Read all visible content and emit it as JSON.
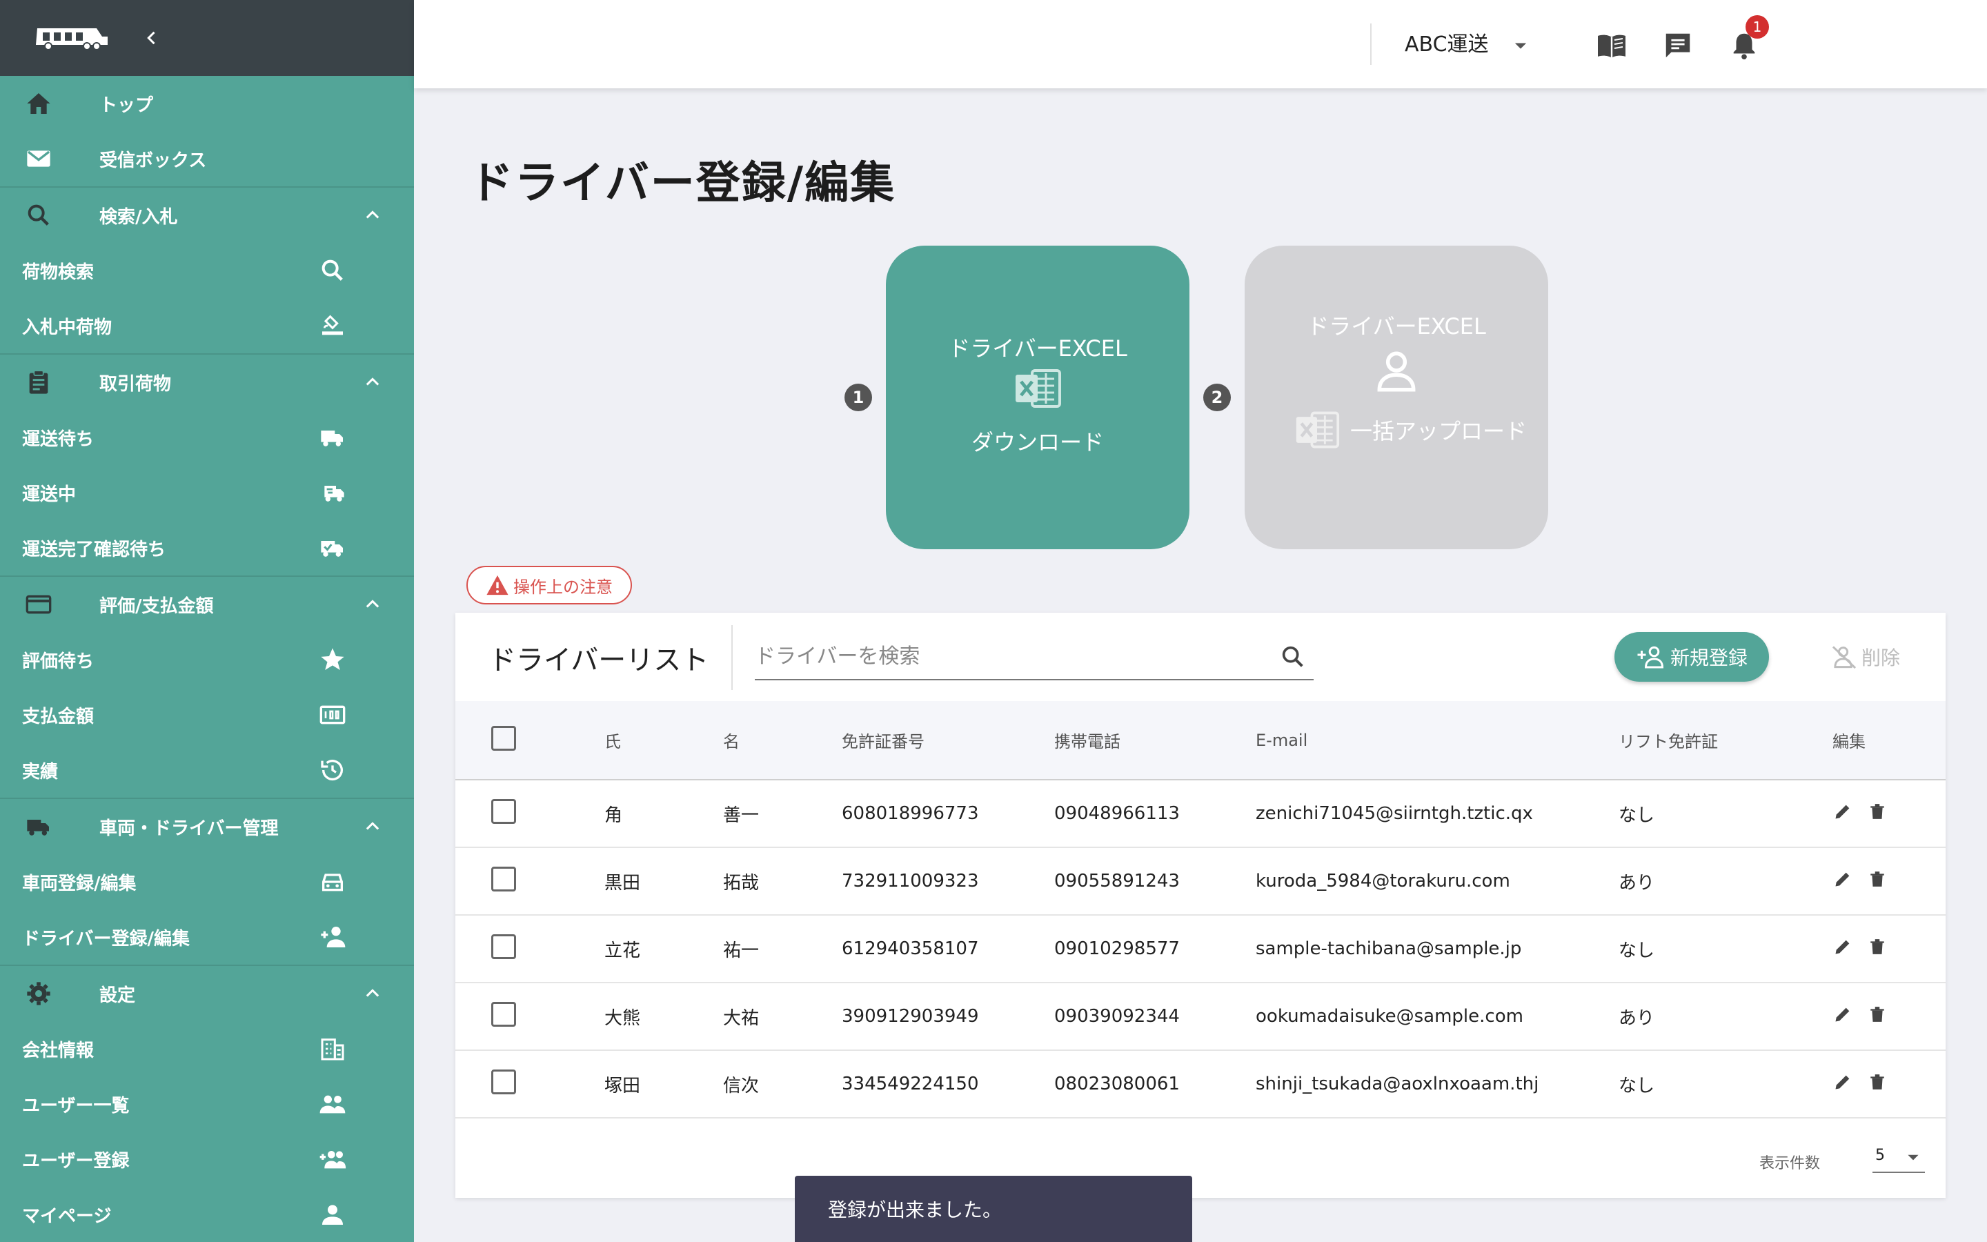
{
  "colors": {
    "accent": "#53a598",
    "sidebar_header": "#3a4348",
    "danger": "#d9534f",
    "badge": "#d32f2f"
  },
  "sidebar": {
    "rows": [
      {
        "type": "section",
        "label": "トップ",
        "icon": "home-icon",
        "chevron": false
      },
      {
        "type": "section",
        "label": "受信ボックス",
        "icon": "mail-icon",
        "chevron": false
      },
      {
        "type": "section",
        "label": "検索/入札",
        "icon": "search-icon",
        "chevron": true
      },
      {
        "type": "sub",
        "label": "荷物検索",
        "icon": "search-icon"
      },
      {
        "type": "sub",
        "label": "入札中荷物",
        "icon": "gavel-icon"
      },
      {
        "type": "section",
        "label": "取引荷物",
        "icon": "clipboard-icon",
        "chevron": true
      },
      {
        "type": "sub",
        "label": "運送待ち",
        "icon": "truck-icon"
      },
      {
        "type": "sub",
        "label": "運送中",
        "icon": "truck-fast-icon"
      },
      {
        "type": "sub",
        "label": "運送完了確認待ち",
        "icon": "truck-check-icon"
      },
      {
        "type": "section",
        "label": "評価/支払金額",
        "icon": "credit-card-icon",
        "chevron": true
      },
      {
        "type": "sub",
        "label": "評価待ち",
        "icon": "star-icon"
      },
      {
        "type": "sub",
        "label": "支払金額",
        "icon": "counter-icon"
      },
      {
        "type": "sub",
        "label": "実績",
        "icon": "history-icon"
      },
      {
        "type": "section",
        "label": "車両・ドライバー管理",
        "icon": "truck-icon",
        "chevron": true
      },
      {
        "type": "sub",
        "label": "車両登録/編集",
        "icon": "car-icon"
      },
      {
        "type": "sub",
        "label": "ドライバー登録/編集",
        "icon": "person-add-icon"
      },
      {
        "type": "section",
        "label": "設定",
        "icon": "gear-icon",
        "chevron": true
      },
      {
        "type": "sub",
        "label": "会社情報",
        "icon": "building-icon"
      },
      {
        "type": "sub",
        "label": "ユーザー一覧",
        "icon": "people-icon"
      },
      {
        "type": "sub",
        "label": "ユーザー登録",
        "icon": "people-add-icon"
      },
      {
        "type": "sub",
        "label": "マイページ",
        "icon": "person-icon"
      }
    ]
  },
  "topbar": {
    "notification_count": "1",
    "company": "ABC運送",
    "icons": [
      "book-icon",
      "chat-icon",
      "bell-icon"
    ]
  },
  "page": {
    "title": "ドライバー登録/編集",
    "steps": [
      {
        "num": "1",
        "line1": "ドライバーEXCEL",
        "line2": "ダウンロード"
      },
      {
        "num": "2",
        "line1": "ドライバーEXCEL",
        "line2": "一括アップロード"
      }
    ],
    "notice": "操作上の注意"
  },
  "list": {
    "title": "ドライバーリスト",
    "search_placeholder": "ドライバーを検索",
    "new_button": "新規登録",
    "delete_button": "削除",
    "headers": [
      "氏",
      "名",
      "免許証番号",
      "携帯電話",
      "E-mail",
      "リフト免許証",
      "編集"
    ],
    "rows": [
      [
        "角",
        "善一",
        "608018996773",
        "09048966113",
        "zenichi71045@siirntgh.tztic.qx",
        "なし"
      ],
      [
        "黒田",
        "拓哉",
        "732911009323",
        "09055891243",
        "kuroda_5984@torakuru.com",
        "あり"
      ],
      [
        "立花",
        "祐一",
        "612940358107",
        "09010298577",
        "sample-tachibana@sample.jp",
        "なし"
      ],
      [
        "大熊",
        "大祐",
        "390912903949",
        "09039092344",
        "ookumadaisuke@sample.com",
        "あり"
      ],
      [
        "塚田",
        "信次",
        "334549224150",
        "08023080061",
        "shinji_tsukada@aoxlnxoaam.thj",
        "なし"
      ]
    ],
    "per_page_label": "表示件数",
    "per_page_value": "5"
  },
  "snackbar": "登録が出来ました。"
}
